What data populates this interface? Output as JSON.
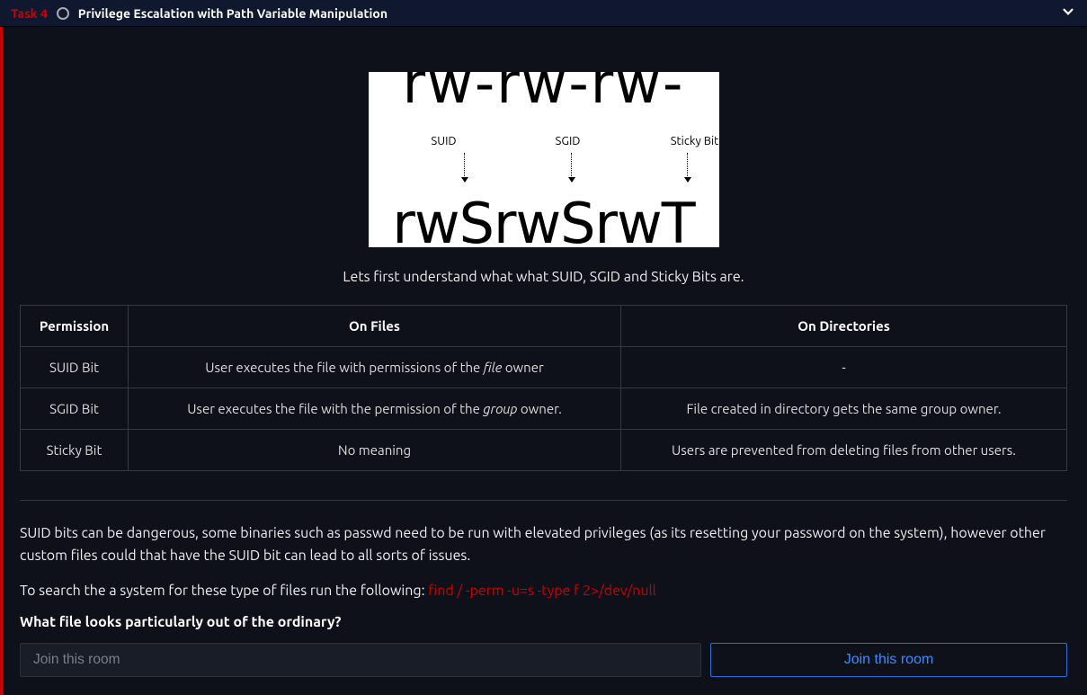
{
  "header": {
    "task_number": "Task 4",
    "title": "Privilege Escalation with Path Variable Manipulation"
  },
  "diagram": {
    "top": "rw-rw-rw-",
    "labels": [
      "SUID",
      "SGID",
      "Sticky Bit"
    ],
    "bottom": "rwSrwSrwT"
  },
  "intro": "Lets first understand what what SUID, SGID and Sticky Bits are.",
  "table": {
    "headers": [
      "Permission",
      "On Files",
      "On Directories"
    ],
    "rows": [
      {
        "perm": "SUID Bit",
        "files_pre": "User executes the file with permissions of the ",
        "files_italic": "file",
        "files_post": " owner",
        "dirs": "-"
      },
      {
        "perm": "SGID Bit",
        "files_pre": "User executes the file with the permission of the ",
        "files_italic": "group",
        "files_post": " owner.",
        "dirs": "File created in directory gets the same group owner."
      },
      {
        "perm": "Sticky Bit",
        "files_pre": "No meaning",
        "files_italic": "",
        "files_post": "",
        "dirs": "Users are prevented from deleting files from other users."
      }
    ]
  },
  "paragraph1": "SUID bits can be dangerous, some binaries such as passwd need to be run with elevated privileges (as its resetting your password on the system), however other custom files could that have the SUID bit can lead to all sorts of issues.",
  "paragraph2_pre": "To search the a system for these type of files run the following: ",
  "paragraph2_cmd": "find / -perm -u=s -type f 2>/dev/null",
  "question": "What file looks particularly out of the ordinary?",
  "answer_placeholder": "Join this room",
  "join_button": "Join this room"
}
